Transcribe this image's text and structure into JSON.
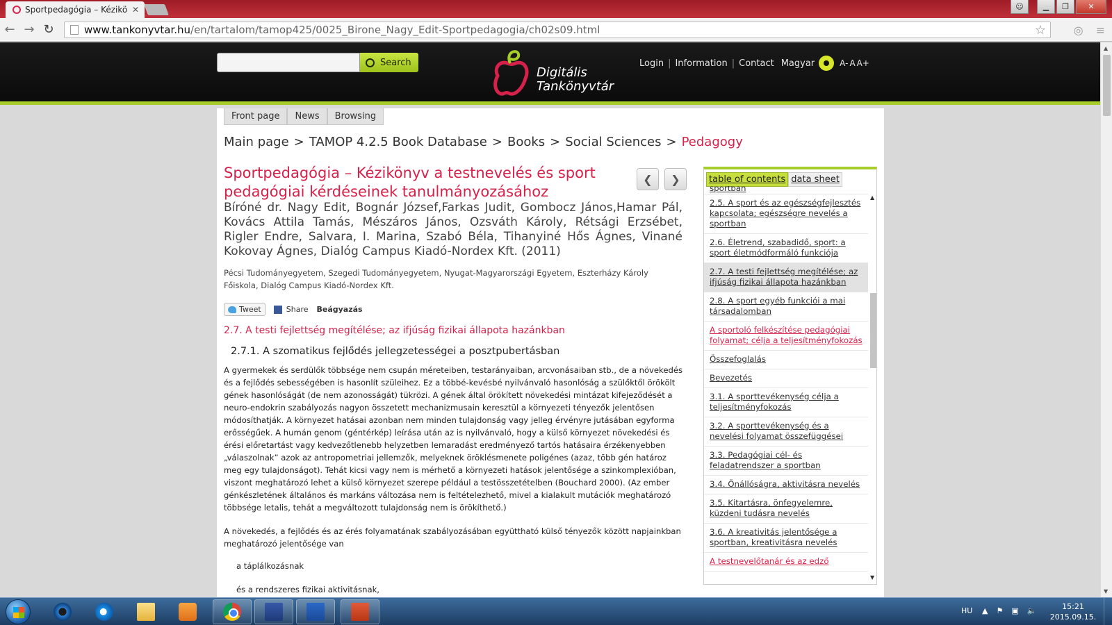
{
  "browser": {
    "tab_title": "Sportpedagógia – Kézikö",
    "url_host": "www.tankonyvtar.hu",
    "url_path": "/en/tartalom/tamop425/0025_Birone_Nagy_Edit-Sportpedagogia/ch02s09.html"
  },
  "header": {
    "search_button": "Search",
    "logo_line1": "Digitális",
    "logo_line2": "Tankönyvtár",
    "nav": [
      "Login",
      "Information",
      "Contact"
    ],
    "language": "Magyar",
    "font_sizes": [
      "A-",
      "A",
      "A+"
    ]
  },
  "subnav": [
    "Front page",
    "News",
    "Browsing"
  ],
  "breadcrumb": [
    "Main page",
    "TAMOP 4.2.5 Book Database",
    "Books",
    "Social Sciences",
    "Pedagogy"
  ],
  "book": {
    "title": "Sportpedagógia – Kézikönyv a testnevelés és sport pedagógiai kérdéseinek tanulmányozásához",
    "authors": "Bíróné dr. Nagy Edit, Bognár József,Farkas Judit, Gombocz János,Hamar Pál, Kovács Attila Tamás, Mészáros János, Ozsváth Károly, Rétsági Erzsébet, Rigler Endre, Salvara, I. Marina, Szabó Béla, Tihanyiné Hős Ágnes, Vinané Kokovay Ágnes, Dialóg Campus Kiadó-Nordex Kft. (2011)",
    "publishers": "Pécsi Tudományegyetem, Szegedi Tudományegyetem, Nyugat-Magyarországi Egyetem, Eszterházy Károly Főiskola, Dialóg Campus Kiadó-Nordex Kft."
  },
  "social": {
    "tweet": "Tweet",
    "share": "Share",
    "embed": "Beágyazás"
  },
  "content": {
    "section_title": "2.7. A testi fejlettség megítélése; az ifjúság fizikai állapota hazánkban",
    "subsection_title": "2.7.1. A szomatikus fejlődés jellegzetességei a posztpubertásban",
    "paragraph1": "A gyermekek és serdülők többsége nem csupán méreteiben, testarányaiban, arcvonásaiban stb., de a növekedés és a fejlődés sebességében is hasonlít szüleihez. Ez a többé-kevésbé nyilvánvaló hasonlóság a szülőktől örökölt gének hasonlóságát (de nem azonosságát) tükrözi. A gének által örökített növekedési mintázat kifejeződését a neuro-endokrin szabályozás nagyon összetett mechanizmusain keresztül a környezeti tényezők jelentősen módosíthatják. A környezet hatásai azonban nem minden tulajdonság vagy jelleg érvényre jutásában egyforma erősségűek. A humán genom (géntérkép) leírása után az is nyilvánvaló, hogy a külső környezet növekedési és érési előretartást vagy kedvezőtlenebb helyzetben lemaradást eredményező tartós hatásaira érzékenyebben „válaszolnak” azok az antropometriai jellemzők, melyeknek öröklésmenete poligénes (azaz, több gén határoz meg egy tulajdonságot). Tehát kicsi vagy nem is mérhető a környezeti hatások jelentősége a szinkomplexióban, viszont meghatározó lehet a külső környezet szerepe például a testösszetételben (Bouchard 2000). (Az ember génkészletének általános és markáns változása nem is feltételezhető, mivel a kialakult mutációk meghatározó többsége letalis, tehát a megváltozott tulajdonság nem is örökíthető.)",
    "paragraph2": "A növekedés, a fejlődés és az érés folyamatának szabályozásában együttható külső tényezők között napjainkban meghatározó jelentősége van",
    "list_item1": "a táplálkozásnak",
    "list_item2": "és a rendszeres fizikai aktivitásnak,"
  },
  "toc": {
    "tab_toc": "table of contents",
    "tab_data": "data sheet",
    "cut_top": "sportban",
    "items": [
      "2.5. A sport és az egészségfejlesztés kapcsolata; egészségre nevelés a sportban",
      "2.6. Életrend, szabadidő, sport: a sport életmódformáló funkciója",
      "2.7. A testi fejlettség megítélése; az ifjúság fizikai állapota hazánkban",
      "2.8. A sport egyéb funkciói a mai társadalomban",
      "A sportoló felkészítése pedagógiai folyamat; célja a teljesítményfokozás",
      "Összefoglalás",
      "Bevezetés",
      "3.1. A sporttevékenység célja a teljesítményfokozás",
      "3.2. A sporttevékenység és a nevelési folyamat összefüggései",
      "3.3. Pedagógiai cél- és feladatrendszer a sportban",
      "3.4. Önállóságra, aktivitásra nevelés",
      "3.5. Kitartásra, önfegyelemre, küzdeni tudásra nevelés",
      "3.6. A kreativitás jelentősége a sportban, kreativitásra nevelés",
      "A testnevelőtanár és az edző"
    ]
  },
  "taskbar": {
    "lang": "HU",
    "time": "15:21",
    "date": "2015.09.15."
  },
  "colors": {
    "accent_green": "#a7cd2b",
    "accent_red": "#d6224b"
  }
}
